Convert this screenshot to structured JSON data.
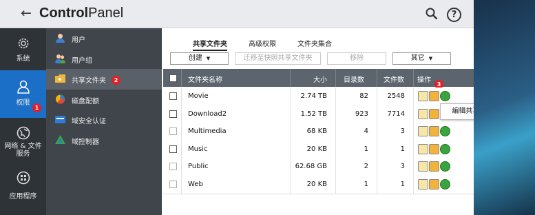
{
  "window": {
    "title_bold": "Control",
    "title_rest": "Panel"
  },
  "left_nav": [
    {
      "label": "系统",
      "icon": "gear-icon"
    },
    {
      "label": "权限",
      "icon": "user-icon",
      "active": true,
      "badge": "1"
    },
    {
      "label": "网络 & 文件服务",
      "icon": "globe-icon"
    },
    {
      "label": "应用程序",
      "icon": "apps-icon"
    }
  ],
  "sub_nav": [
    {
      "label": "用户",
      "icon": "user-icon"
    },
    {
      "label": "用户组",
      "icon": "user-group-icon"
    },
    {
      "label": "共享文件夹",
      "icon": "shared-folder-icon",
      "active": true,
      "badge": "2"
    },
    {
      "label": "磁盘配额",
      "icon": "disk-quota-icon"
    },
    {
      "label": "域安全认证",
      "icon": "domain-security-icon"
    },
    {
      "label": "域控制器",
      "icon": "domain-controller-icon"
    }
  ],
  "tabs": [
    "共享文件夹",
    "高级权限",
    "文件夹集合"
  ],
  "toolbar": {
    "create": "创建",
    "migrate": "迁移至快照共享文件夹",
    "remove": "移除",
    "other": "其它"
  },
  "table": {
    "headers": [
      "文件夹名称",
      "大小",
      "目录数",
      "文件数",
      "操作"
    ],
    "rows": [
      {
        "name": "Movie",
        "size": "2.74 TB",
        "dirs": "82",
        "files": "2548"
      },
      {
        "name": "Download2",
        "size": "1.52 TB",
        "dirs": "923",
        "files": "7714"
      },
      {
        "name": "Multimedia",
        "size": "68 KB",
        "dirs": "4",
        "files": "3"
      },
      {
        "name": "Music",
        "size": "20 KB",
        "dirs": "1",
        "files": "1"
      },
      {
        "name": "Public",
        "size": "62.68 GB",
        "dirs": "2",
        "files": "3"
      },
      {
        "name": "Web",
        "size": "20 KB",
        "dirs": "1",
        "files": "1"
      }
    ]
  },
  "action_badge": "3",
  "tooltip": "编辑共享文件夹权限",
  "colors": {
    "nav_active": "#1b6fc6",
    "badge": "#e21f26",
    "table_header": "#5c646d"
  }
}
